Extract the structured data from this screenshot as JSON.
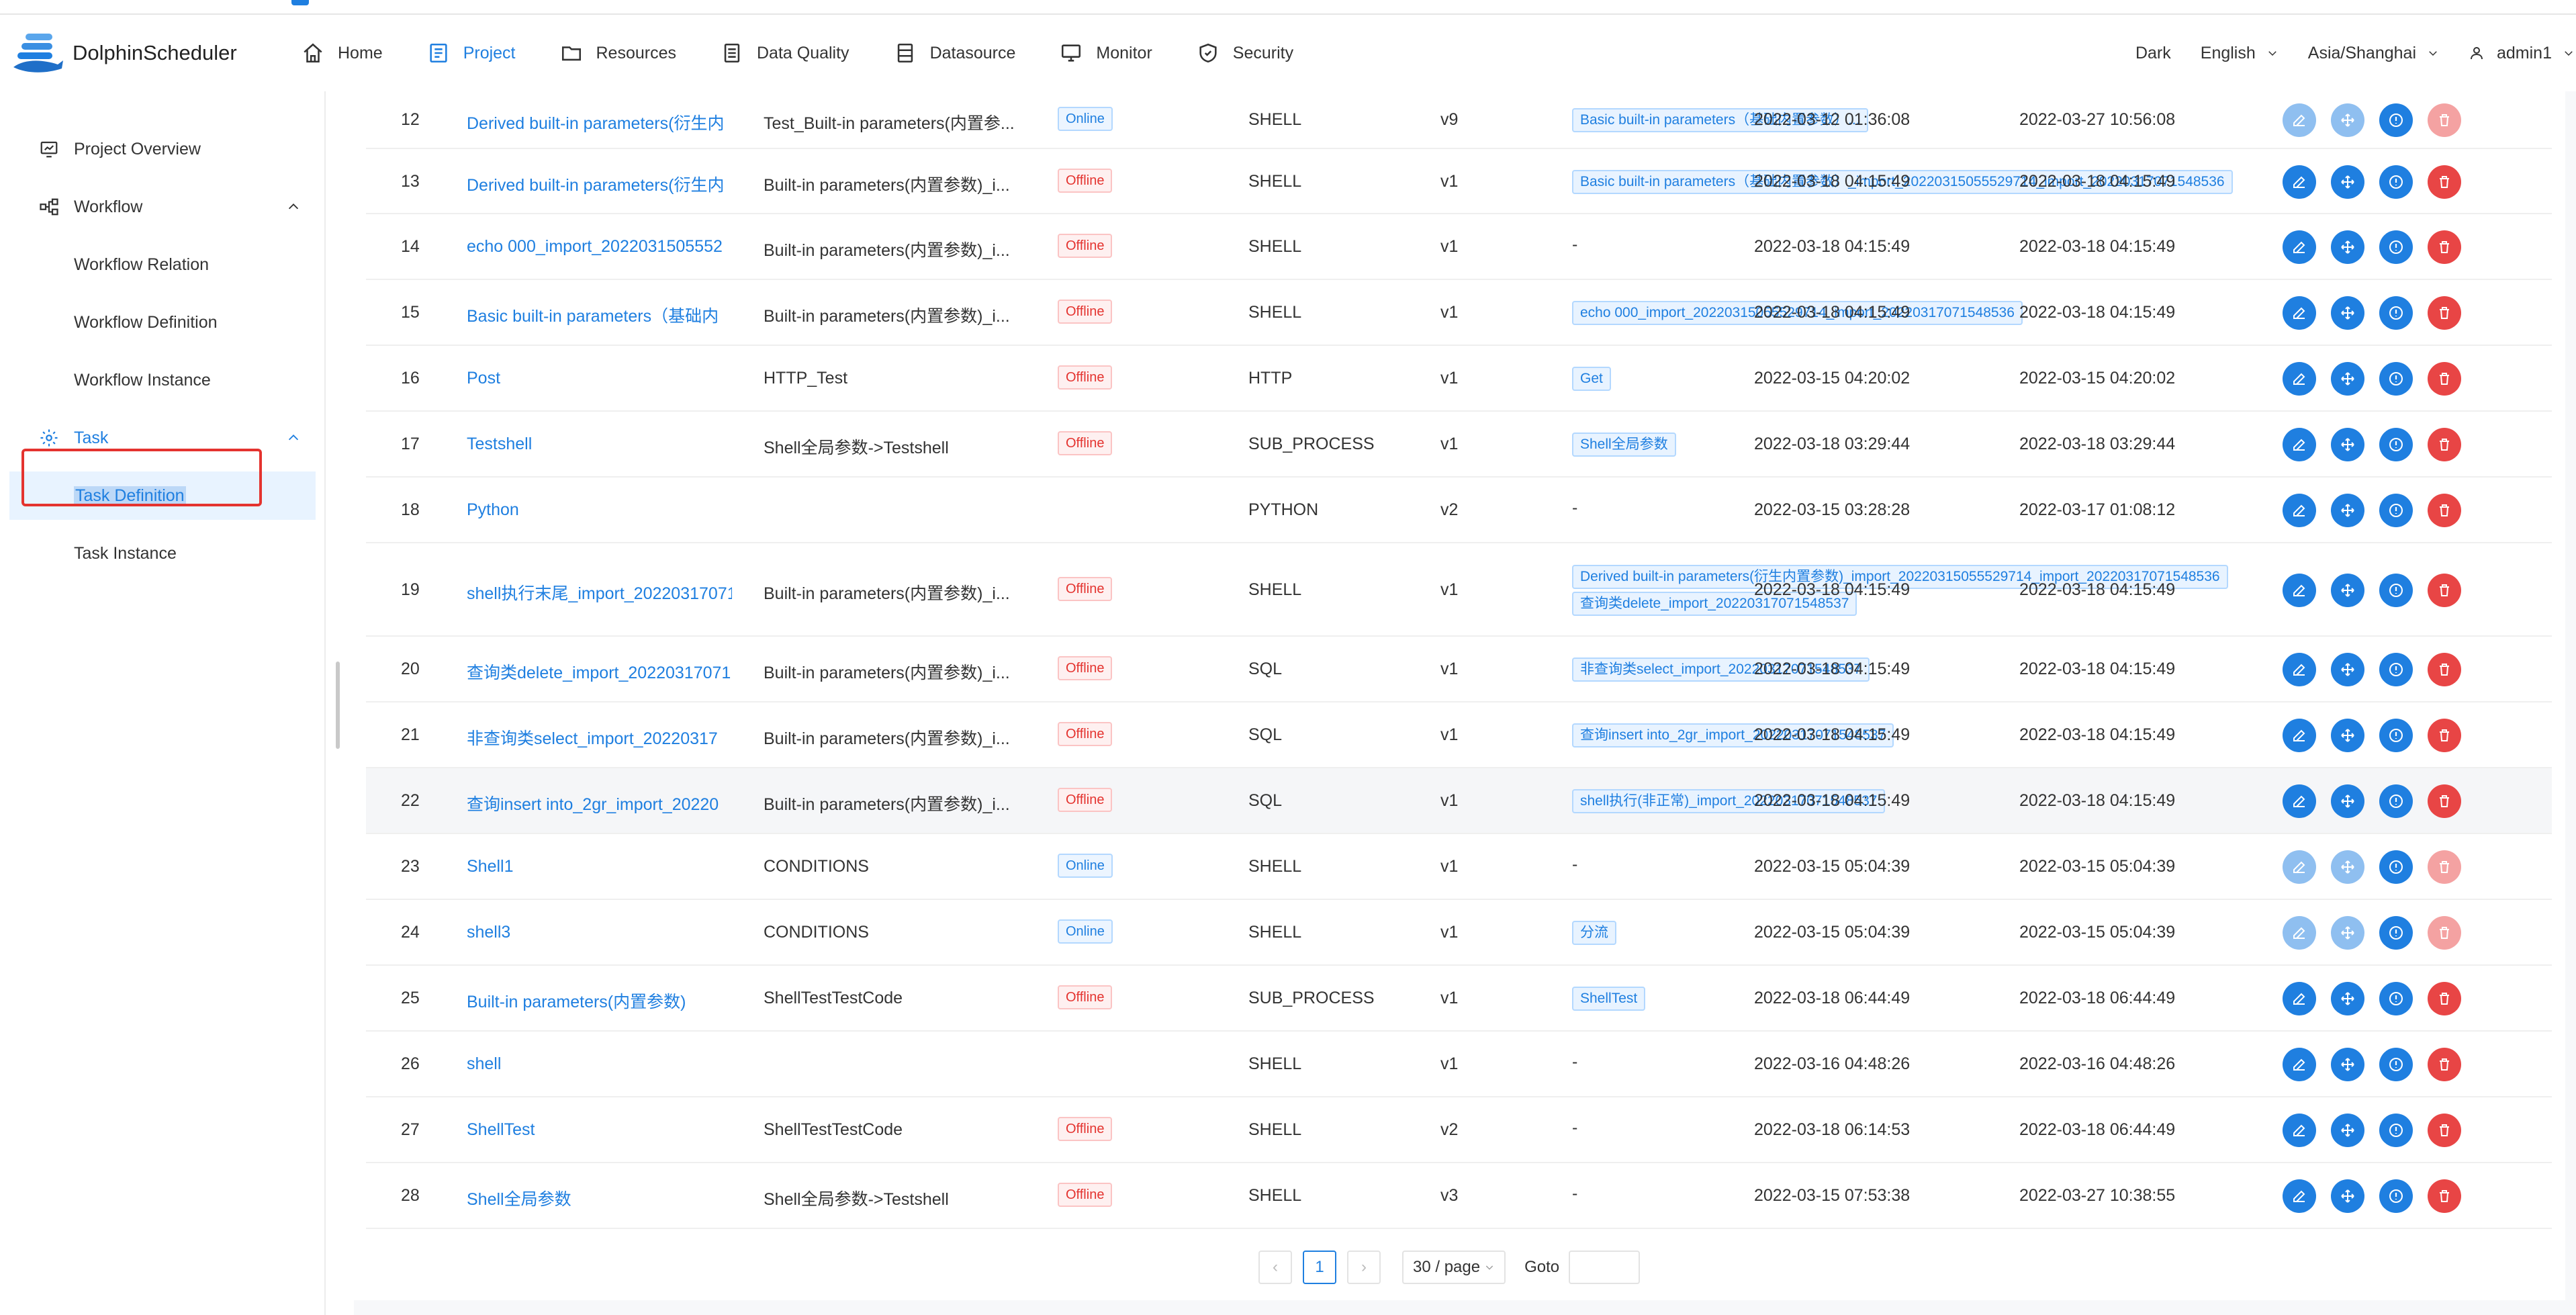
{
  "app": {
    "name": "DolphinScheduler"
  },
  "nav": [
    {
      "label": "Home",
      "icon": "home-icon"
    },
    {
      "label": "Project",
      "icon": "project-icon",
      "active": true
    },
    {
      "label": "Resources",
      "icon": "folder-icon"
    },
    {
      "label": "Data Quality",
      "icon": "document-icon"
    },
    {
      "label": "Datasource",
      "icon": "database-icon"
    },
    {
      "label": "Monitor",
      "icon": "monitor-icon"
    },
    {
      "label": "Security",
      "icon": "shield-icon"
    }
  ],
  "header_right": {
    "theme": "Dark",
    "language": "English",
    "timezone": "Asia/Shanghai",
    "user": "admin1"
  },
  "sidebar": {
    "project_overview": "Project Overview",
    "workflow": "Workflow",
    "workflow_relation": "Workflow Relation",
    "workflow_definition": "Workflow Definition",
    "workflow_instance": "Workflow Instance",
    "task": "Task",
    "task_definition": "Task Definition",
    "task_instance": "Task Instance"
  },
  "rows": [
    {
      "idx": "12",
      "name": "Derived built-in parameters(衍生内",
      "process": "Test_Built-in parameters(内置参...",
      "state": "Online",
      "type": "SHELL",
      "version": "v9",
      "upstream": [
        "Basic built-in parameters（基础内置参数）..."
      ],
      "created": "2022-03-12 01:36:08",
      "updated": "2022-03-27 10:56:08",
      "ops_enabled": false
    },
    {
      "idx": "13",
      "name": "Derived built-in parameters(衍生内",
      "process": "Built-in parameters(内置参数)_i...",
      "state": "Offline",
      "type": "SHELL",
      "version": "v1",
      "upstream": [
        "Basic built-in parameters（基础内置参数）_import_20220315055529714_import_20220317071548536"
      ],
      "created": "2022-03-18 04:15:49",
      "updated": "2022-03-18 04:15:49",
      "ops_enabled": true
    },
    {
      "idx": "14",
      "name": "echo 000_import_2022031505552",
      "process": "Built-in parameters(内置参数)_i...",
      "state": "Offline",
      "type": "SHELL",
      "version": "v1",
      "upstream": [
        "-"
      ],
      "created": "2022-03-18 04:15:49",
      "updated": "2022-03-18 04:15:49",
      "ops_enabled": true
    },
    {
      "idx": "15",
      "name": "Basic built-in parameters（基础内",
      "process": "Built-in parameters(内置参数)_i...",
      "state": "Offline",
      "type": "SHELL",
      "version": "v1",
      "upstream": [
        "echo 000_import_20220315055529714_import_20220317071548536"
      ],
      "created": "2022-03-18 04:15:49",
      "updated": "2022-03-18 04:15:49",
      "ops_enabled": true
    },
    {
      "idx": "16",
      "name": "Post",
      "process": "HTTP_Test",
      "state": "Offline",
      "type": "HTTP",
      "version": "v1",
      "upstream": [
        "Get"
      ],
      "created": "2022-03-15 04:20:02",
      "updated": "2022-03-15 04:20:02",
      "ops_enabled": true
    },
    {
      "idx": "17",
      "name": "Testshell",
      "process": "Shell全局参数->Testshell",
      "state": "Offline",
      "type": "SUB_PROCESS",
      "version": "v1",
      "upstream": [
        "Shell全局参数"
      ],
      "created": "2022-03-18 03:29:44",
      "updated": "2022-03-18 03:29:44",
      "ops_enabled": true
    },
    {
      "idx": "18",
      "name": "Python",
      "process": "",
      "state": "",
      "type": "PYTHON",
      "version": "v2",
      "upstream": [
        "-"
      ],
      "created": "2022-03-15 03:28:28",
      "updated": "2022-03-17 01:08:12",
      "ops_enabled": true
    },
    {
      "idx": "19",
      "name": "shell执行末尾_import_20220317071",
      "process": "Built-in parameters(内置参数)_i...",
      "state": "Offline",
      "type": "SHELL",
      "version": "v1",
      "upstream": [
        "Derived built-in parameters(衍生内置参数)_import_20220315055529714_import_20220317071548536",
        "查询类delete_import_20220317071548537"
      ],
      "created": "2022-03-18 04:15:49",
      "updated": "2022-03-18 04:15:49",
      "ops_enabled": true
    },
    {
      "idx": "20",
      "name": "查询类delete_import_20220317071",
      "process": "Built-in parameters(内置参数)_i...",
      "state": "Offline",
      "type": "SQL",
      "version": "v1",
      "upstream": [
        "非查询类select_import_20220317071548537"
      ],
      "created": "2022-03-18 04:15:49",
      "updated": "2022-03-18 04:15:49",
      "ops_enabled": true
    },
    {
      "idx": "21",
      "name": "非查询类select_import_20220317",
      "process": "Built-in parameters(内置参数)_i...",
      "state": "Offline",
      "type": "SQL",
      "version": "v1",
      "upstream": [
        "查询insert into_2gr_import_20220317071548537"
      ],
      "created": "2022-03-18 04:15:49",
      "updated": "2022-03-18 04:15:49",
      "ops_enabled": true
    },
    {
      "idx": "22",
      "name": "查询insert into_2gr_import_20220",
      "process": "Built-in parameters(内置参数)_i...",
      "state": "Offline",
      "type": "SQL",
      "version": "v1",
      "upstream": [
        "shell执行(非正常)_import_20220317071548537"
      ],
      "created": "2022-03-18 04:15:49",
      "updated": "2022-03-18 04:15:49",
      "ops_enabled": true,
      "hover": true
    },
    {
      "idx": "23",
      "name": "Shell1",
      "process": "CONDITIONS",
      "state": "Online",
      "type": "SHELL",
      "version": "v1",
      "upstream": [
        "-"
      ],
      "created": "2022-03-15 05:04:39",
      "updated": "2022-03-15 05:04:39",
      "ops_enabled": false
    },
    {
      "idx": "24",
      "name": "shell3",
      "process": "CONDITIONS",
      "state": "Online",
      "type": "SHELL",
      "version": "v1",
      "upstream": [
        "分流"
      ],
      "created": "2022-03-15 05:04:39",
      "updated": "2022-03-15 05:04:39",
      "ops_enabled": false
    },
    {
      "idx": "25",
      "name": "Built-in parameters(内置参数)",
      "process": "ShellTestTestCode",
      "state": "Offline",
      "type": "SUB_PROCESS",
      "version": "v1",
      "upstream": [
        "ShellTest"
      ],
      "created": "2022-03-18 06:44:49",
      "updated": "2022-03-18 06:44:49",
      "ops_enabled": true
    },
    {
      "idx": "26",
      "name": "shell",
      "process": "",
      "state": "",
      "type": "SHELL",
      "version": "v1",
      "upstream": [
        "-"
      ],
      "created": "2022-03-16 04:48:26",
      "updated": "2022-03-16 04:48:26",
      "ops_enabled": true
    },
    {
      "idx": "27",
      "name": "ShellTest",
      "process": "ShellTestTestCode",
      "state": "Offline",
      "type": "SHELL",
      "version": "v2",
      "upstream": [
        "-"
      ],
      "created": "2022-03-18 06:14:53",
      "updated": "2022-03-18 06:44:49",
      "ops_enabled": true
    },
    {
      "idx": "28",
      "name": "Shell全局参数",
      "process": "Shell全局参数->Testshell",
      "state": "Offline",
      "type": "SHELL",
      "version": "v3",
      "upstream": [
        "-"
      ],
      "created": "2022-03-15 07:53:38",
      "updated": "2022-03-27 10:38:55",
      "ops_enabled": true
    }
  ],
  "pagination": {
    "prev": "‹",
    "current": "1",
    "next": "›",
    "page_size": "30 / page",
    "goto_label": "Goto",
    "goto_value": ""
  },
  "colors": {
    "accent": "#1f7fe0",
    "danger": "#e84545",
    "selected_box": "#e4332f"
  }
}
